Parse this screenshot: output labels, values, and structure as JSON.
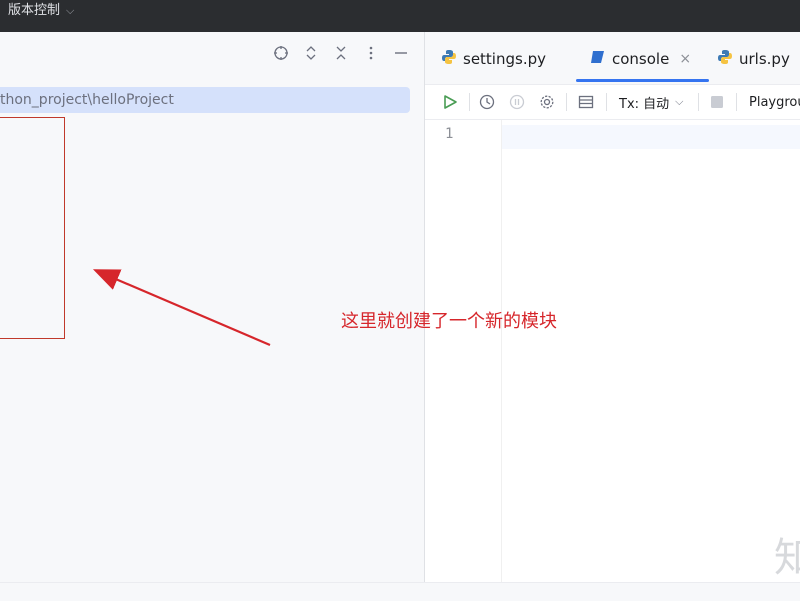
{
  "titlebar": {
    "vcs_label": "版本控制"
  },
  "project_panel": {
    "path_text": "thon_project\\helloProject"
  },
  "tabs": [
    {
      "label": "settings.py",
      "icon": "python-icon"
    },
    {
      "label": "console",
      "icon": "console-icon",
      "active": true,
      "close": "×"
    },
    {
      "label": "urls.py",
      "icon": "python-icon"
    }
  ],
  "editor_toolbar": {
    "tx_label": "Tx: 自动",
    "playground_label": "Playgrou"
  },
  "editor": {
    "line_numbers": [
      "1"
    ]
  },
  "annotation": {
    "text": "这里就创建了一个新的模块"
  },
  "watermark": {
    "text": "知"
  },
  "colors": {
    "accent": "#3574f0",
    "annotation_red": "#d6262b",
    "run_green": "#499c54"
  }
}
